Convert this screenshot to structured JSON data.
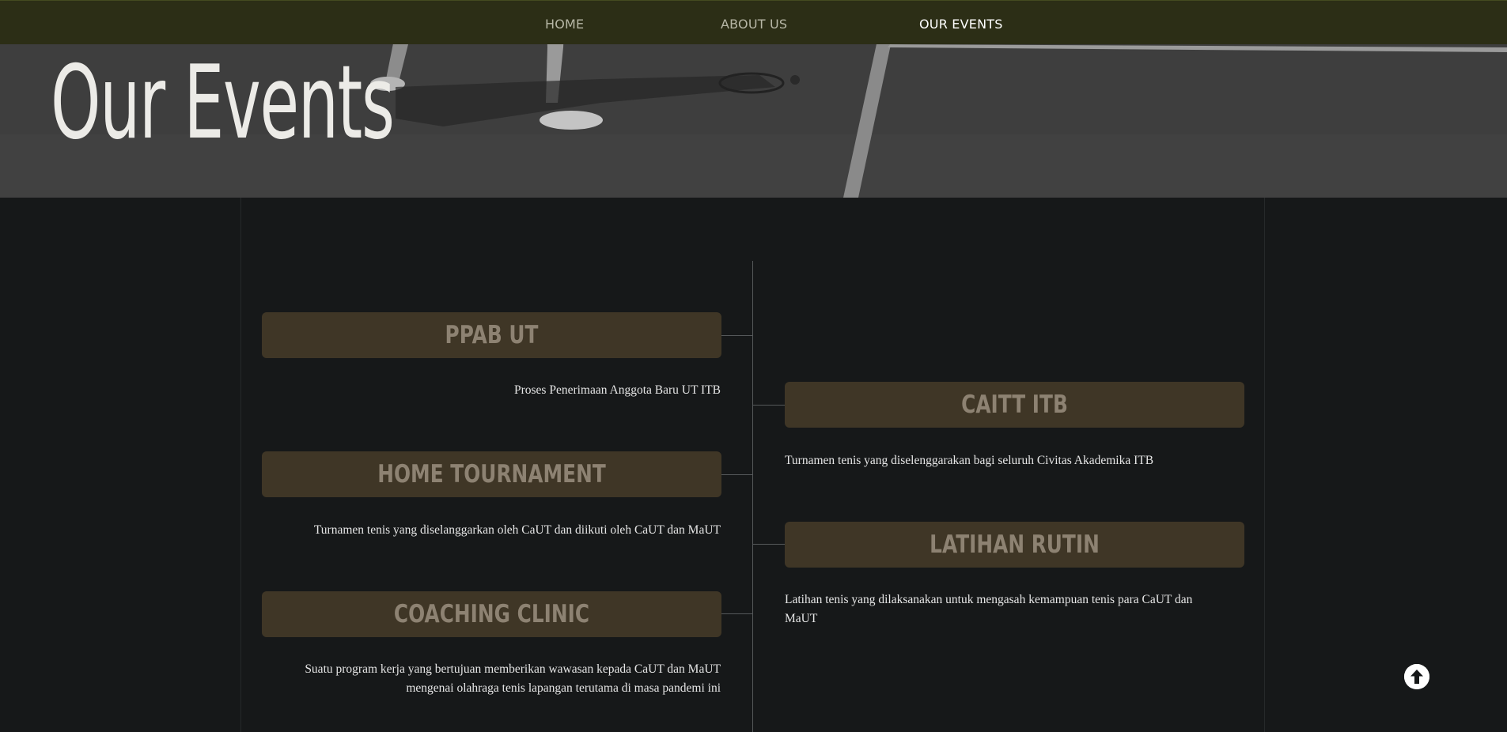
{
  "nav": {
    "items": [
      {
        "label": "HOME",
        "active": false
      },
      {
        "label": "ABOUT US",
        "active": false
      },
      {
        "label": "OUR EVENTS",
        "active": true
      }
    ]
  },
  "hero": {
    "title": "Our Events"
  },
  "events": {
    "left": [
      {
        "title": "PPAB UT",
        "description": "Proses Penerimaan Anggota Baru UT ITB"
      },
      {
        "title": "HOME TOURNAMENT",
        "description": "Turnamen tenis yang diselanggarkan oleh CaUT dan diikuti oleh CaUT dan MaUT"
      },
      {
        "title": "COACHING CLINIC",
        "description": "Suatu program kerja yang bertujuan memberikan wawasan kepada CaUT dan MaUT mengenai olahraga tenis lapangan terutama di masa pandemi ini"
      }
    ],
    "right": [
      {
        "title": "CAITT ITB",
        "description": "Turnamen tenis yang diselenggarakan bagi seluruh Civitas Akademika ITB"
      },
      {
        "title": "LATIHAN RUTIN",
        "description": "Latihan tenis yang dilaksanakan untuk mengasah kemampuan tenis para CaUT dan MaUT"
      }
    ]
  },
  "colors": {
    "nav_bg": "#2c2e16",
    "page_bg": "#161819",
    "event_box_bg": "#3f3626",
    "event_title": "#8d8272",
    "description_text": "#e6e6e6"
  },
  "icons": {
    "back_to_top": "arrow-up-circle-icon"
  }
}
